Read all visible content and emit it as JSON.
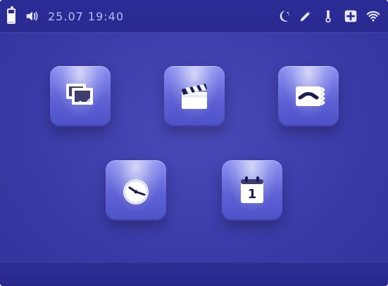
{
  "statusbar": {
    "datetime": "25.07 19:40"
  },
  "icons": {
    "battery": "battery-icon",
    "volume": "speaker-icon",
    "night": "moon-icon",
    "edit": "pencil-icon",
    "thermo": "thermometer-icon",
    "add": "plus-box-icon",
    "wifi": "wifi-icon"
  },
  "apps": {
    "calendar_day": "1"
  },
  "colors": {
    "background": "#3b3ba9",
    "statusbar": "#2b2b95",
    "tile_light": "#8e92f2",
    "tile_dark": "#4d51c7",
    "icon_text": "#d8dbff"
  }
}
